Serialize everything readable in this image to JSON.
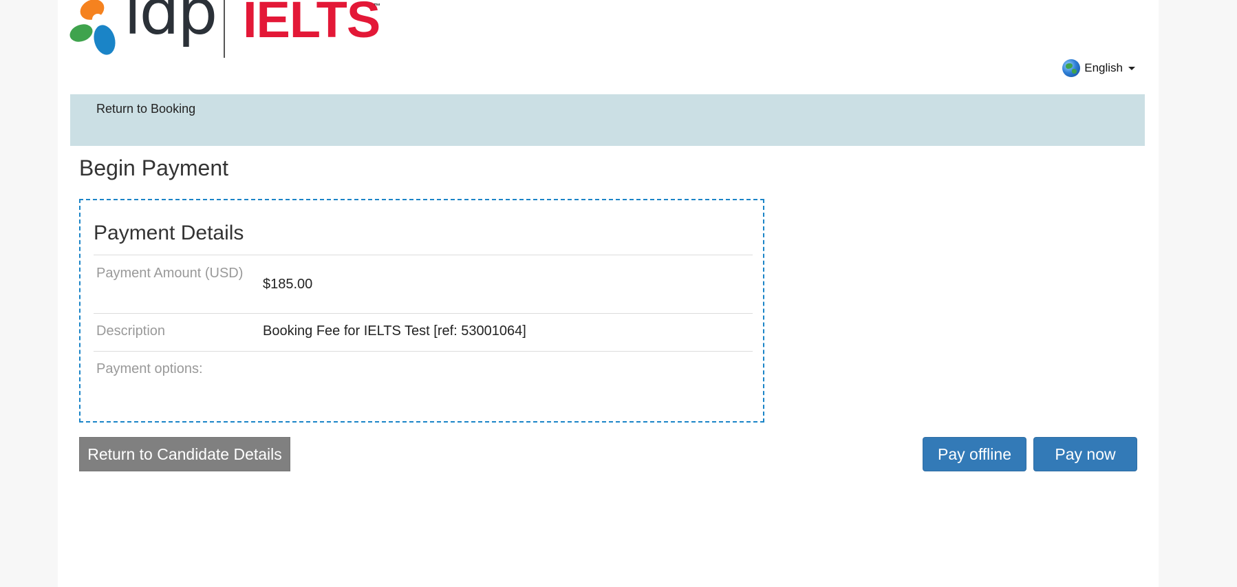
{
  "brand": {
    "primary_logo_text": "idp",
    "secondary_logo_text": "IELTS",
    "trademark": "™",
    "ielts_color": "#e31837",
    "petal_colors": [
      "#f5821f",
      "#3fa34d",
      "#1a84c7"
    ]
  },
  "language": {
    "selected": "English",
    "icon": "globe-icon"
  },
  "nav": {
    "return_to_booking": "Return to Booking",
    "band_color": "#cbdfe4"
  },
  "page": {
    "title": "Begin Payment"
  },
  "payment_details": {
    "title": "Payment Details",
    "amount_label": "Payment Amount (USD)",
    "amount_value": "$185.00",
    "description_label": "Description",
    "description_value": "Booking Fee for IELTS Test [ref: 53001064]",
    "options_label": "Payment options:"
  },
  "actions": {
    "return_candidate": "Return to Candidate Details",
    "pay_offline": "Pay offline",
    "pay_now": "Pay now",
    "primary_color": "#337ab7",
    "secondary_color": "#808080"
  }
}
